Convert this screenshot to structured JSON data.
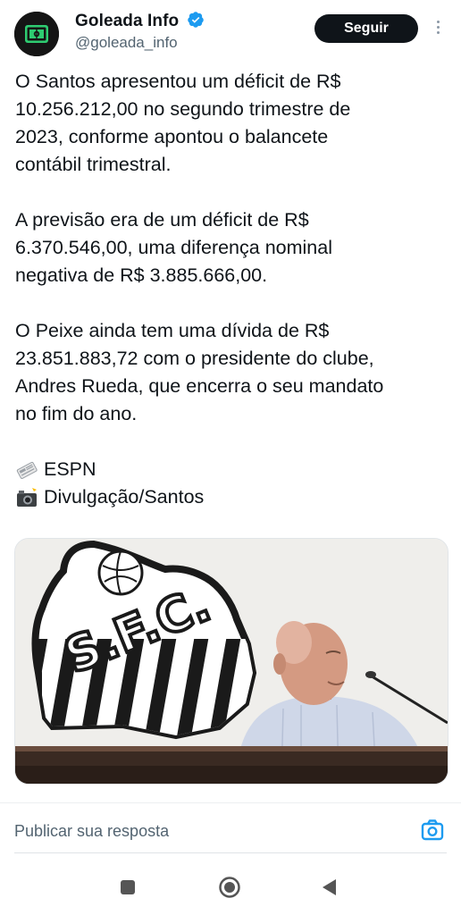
{
  "header": {
    "account_name": "Goleada Info",
    "handle": "@goleada_info",
    "follow_label": "Seguir",
    "verified_color": "#1d9bf0"
  },
  "tweet": {
    "paragraph_1": [
      "O Santos apresentou um déficit de R$",
      "10.256.212,00 no segundo trimestre de",
      "2023, conforme apontou o balancete",
      "contábil trimestral."
    ],
    "paragraph_2": [
      "A previsão era de um déficit de R$",
      "6.370.546,00, uma diferença nominal",
      "negativa de R$ 3.885.666,00."
    ],
    "paragraph_3": [
      "O Peixe ainda tem uma dívida de R$",
      "23.851.883,72 com o presidente do clube,",
      "Andres Rueda, que encerra o seu mandato",
      "no fim do ano."
    ],
    "source_1": {
      "icon": "newspaper-icon",
      "text": "ESPN"
    },
    "source_2": {
      "icon": "camera-flash-icon",
      "text": "Divulgação/Santos"
    }
  },
  "media": {
    "crest_text": "S.F.C."
  },
  "reply": {
    "placeholder": "Publicar sua resposta",
    "camera_icon": "camera-icon",
    "accent_color": "#1d9bf0"
  },
  "system_nav": {
    "items": [
      "recents-icon",
      "home-icon",
      "back-icon"
    ]
  }
}
